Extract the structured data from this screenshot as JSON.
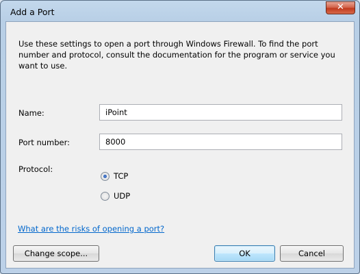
{
  "window": {
    "title": "Add a Port",
    "close_glyph": "✕"
  },
  "dialog": {
    "intro": "Use these settings to open a port through Windows Firewall. To find the port number and protocol, consult the documentation for the program or service you want to use.",
    "name_label": "Name:",
    "name_value": "iPoint",
    "port_label": "Port number:",
    "port_value": "8000",
    "protocol_label": "Protocol:",
    "protocol_options": [
      {
        "label": "TCP",
        "selected": true
      },
      {
        "label": "UDP",
        "selected": false
      }
    ],
    "risks_link": "What are the risks of opening a port?",
    "change_scope_label": "Change scope...",
    "ok_label": "OK",
    "cancel_label": "Cancel"
  }
}
